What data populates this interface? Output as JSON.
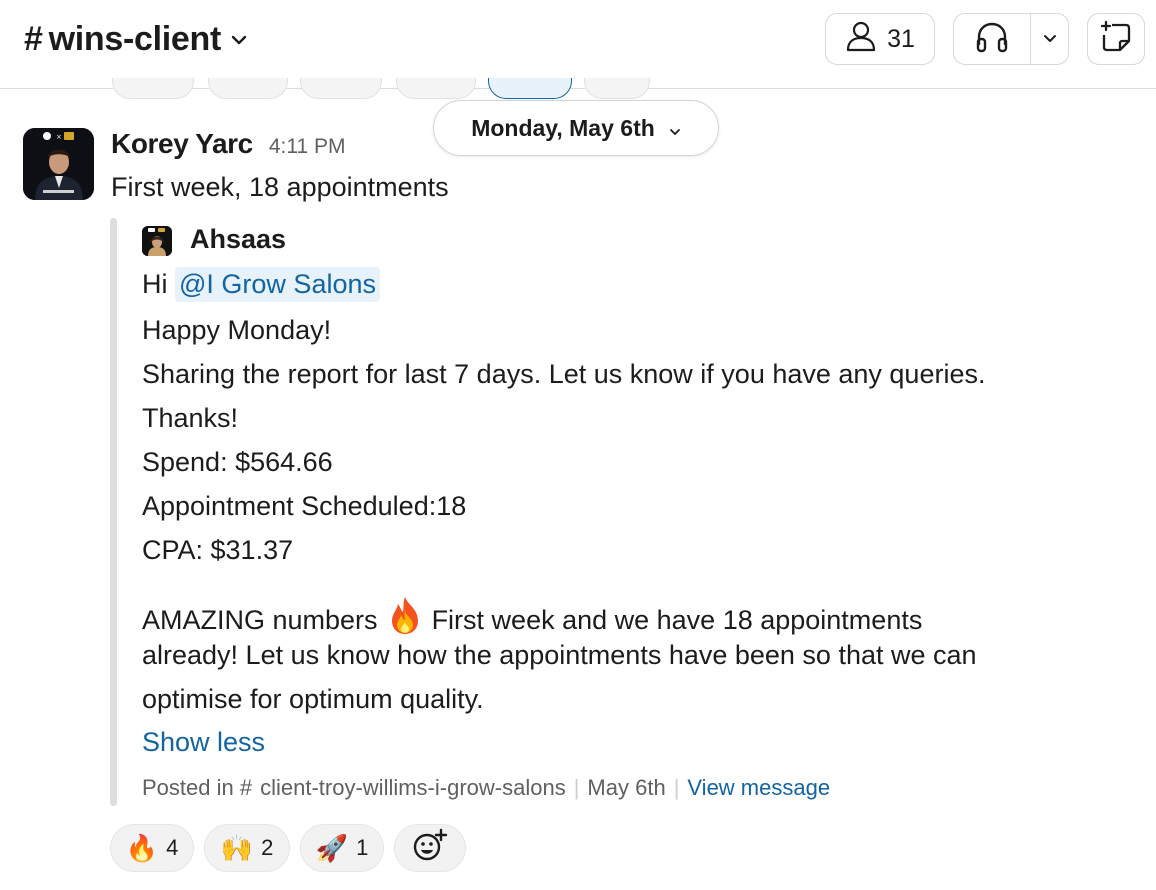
{
  "header": {
    "channel_hash": "#",
    "channel_name": "wins-client",
    "member_count": "31",
    "icons": {
      "members": "person-icon",
      "huddle": "headphones-icon",
      "huddle_menu": "chevron-down-icon",
      "canvas": "new-canvas-icon"
    }
  },
  "date_divider": {
    "label": "Monday, May 6th"
  },
  "message": {
    "sender": "Korey Yarc",
    "time": "4:11 PM",
    "text": "First week, 18 appointments",
    "shared": {
      "author": "Ahsaas",
      "greeting": "Hi",
      "mention": "@I Grow Salons",
      "lines": [
        "Happy Monday!",
        "Sharing the report for last 7 days. Let us know if you have any queries.",
        "Thanks!",
        "Spend: $564.66",
        "Appointment Scheduled:18",
        "CPA: $31.37"
      ],
      "body_part1": "AMAZING numbers",
      "body_part2": "First week and we have 18 appointments",
      "body_line2": "already! Let us know how the appointments have been so that we can",
      "body_line3": "optimise for optimum quality.",
      "show_less": "Show less",
      "footer": {
        "posted_in": "Posted in",
        "hash": "#",
        "channel": "client-troy-willims-i-grow-salons",
        "date": "May 6th",
        "view": "View message"
      }
    },
    "reactions": [
      {
        "emoji": "🔥",
        "count": "4"
      },
      {
        "emoji": "🙌",
        "count": "2"
      },
      {
        "emoji": "🚀",
        "count": "1"
      }
    ],
    "add_reaction_icon": "add-emoji-icon"
  },
  "colors": {
    "link": "#1264a3",
    "mention_bg": "#e8f2fa",
    "muted": "#616061",
    "text": "#1d1c1d"
  }
}
